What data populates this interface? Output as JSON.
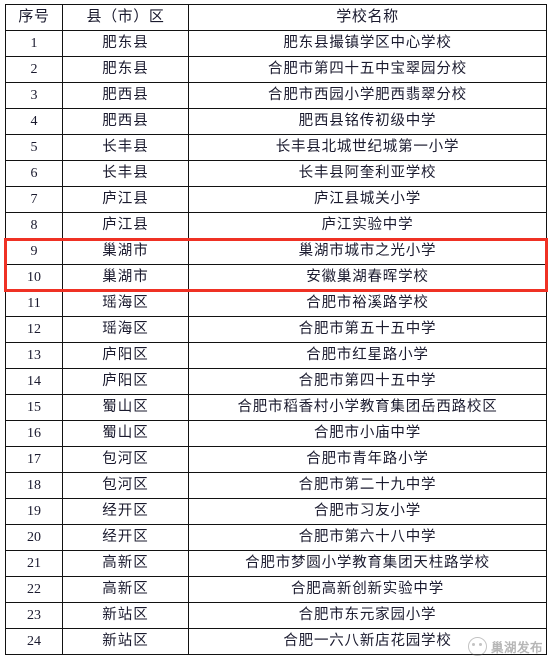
{
  "table": {
    "headers": {
      "index": "序号",
      "district": "县（市）区",
      "school": "学校名称"
    },
    "rows": [
      {
        "index": "1",
        "district": "肥东县",
        "school": "肥东县撮镇学区中心学校"
      },
      {
        "index": "2",
        "district": "肥东县",
        "school": "合肥市第四十五中宝翠园分校"
      },
      {
        "index": "3",
        "district": "肥西县",
        "school": "合肥市西园小学肥西翡翠分校"
      },
      {
        "index": "4",
        "district": "肥西县",
        "school": "肥西县铭传初级中学"
      },
      {
        "index": "5",
        "district": "长丰县",
        "school": "长丰县北城世纪城第一小学"
      },
      {
        "index": "6",
        "district": "长丰县",
        "school": "长丰县阿奎利亚学校"
      },
      {
        "index": "7",
        "district": "庐江县",
        "school": "庐江县城关小学"
      },
      {
        "index": "8",
        "district": "庐江县",
        "school": "庐江实验中学"
      },
      {
        "index": "9",
        "district": "巢湖市",
        "school": "巢湖市城市之光小学"
      },
      {
        "index": "10",
        "district": "巢湖市",
        "school": "安徽巢湖春晖学校"
      },
      {
        "index": "11",
        "district": "瑶海区",
        "school": "合肥市裕溪路学校"
      },
      {
        "index": "12",
        "district": "瑶海区",
        "school": "合肥市第五十五中学"
      },
      {
        "index": "13",
        "district": "庐阳区",
        "school": "合肥市红星路小学"
      },
      {
        "index": "14",
        "district": "庐阳区",
        "school": "合肥市第四十五中学"
      },
      {
        "index": "15",
        "district": "蜀山区",
        "school": "合肥市稻香村小学教育集团岳西路校区"
      },
      {
        "index": "16",
        "district": "蜀山区",
        "school": "合肥市小庙中学"
      },
      {
        "index": "17",
        "district": "包河区",
        "school": "合肥市青年路小学"
      },
      {
        "index": "18",
        "district": "包河区",
        "school": "合肥市第二十九中学"
      },
      {
        "index": "19",
        "district": "经开区",
        "school": "合肥市习友小学"
      },
      {
        "index": "20",
        "district": "经开区",
        "school": "合肥市第六十八中学"
      },
      {
        "index": "21",
        "district": "高新区",
        "school": "合肥市梦圆小学教育集团天柱路学校"
      },
      {
        "index": "22",
        "district": "高新区",
        "school": "合肥高新创新实验中学"
      },
      {
        "index": "23",
        "district": "新站区",
        "school": "合肥市东元家园小学"
      },
      {
        "index": "24",
        "district": "新站区",
        "school": "合肥一六八新店花园学校"
      }
    ]
  },
  "highlight": {
    "color": "#ef3124",
    "from_index": "9",
    "to_index": "10"
  },
  "watermark": {
    "text": "巢湖发布",
    "logo": "circle-face-logo"
  }
}
